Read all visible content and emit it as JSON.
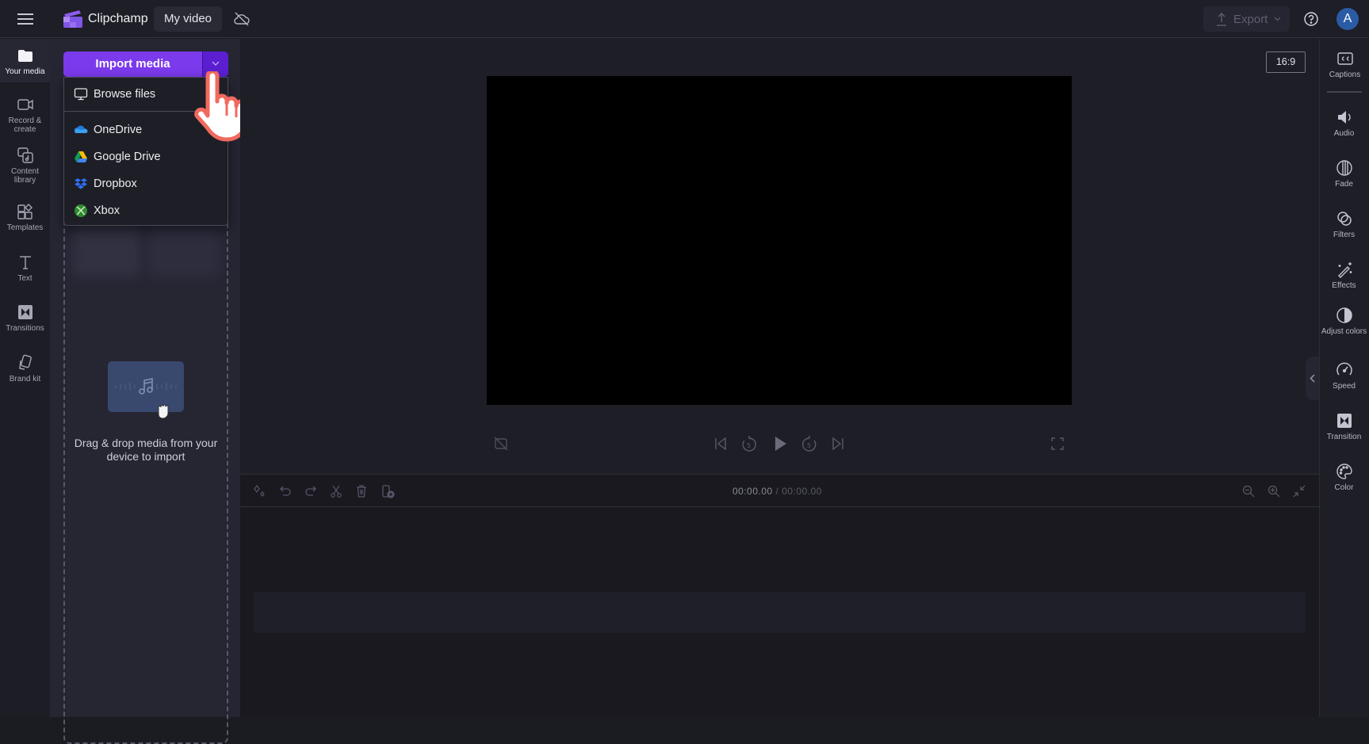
{
  "app": {
    "name": "Clipchamp",
    "project_title": "My video",
    "export_label": "Export",
    "avatar_initial": "A",
    "accent_color": "#7c3aed"
  },
  "left_rail": {
    "items": [
      {
        "label": "Your media",
        "icon": "folder-icon",
        "active": true
      },
      {
        "label": "Record & create",
        "icon": "video-camera-icon"
      },
      {
        "label": "Content library",
        "icon": "content-library-icon"
      },
      {
        "label": "Templates",
        "icon": "templates-icon"
      },
      {
        "label": "Text",
        "icon": "text-icon"
      },
      {
        "label": "Transitions",
        "icon": "transitions-icon"
      },
      {
        "label": "Brand kit",
        "icon": "brand-kit-icon"
      }
    ]
  },
  "media_panel": {
    "import_label": "Import media",
    "drop_text": "Drag & drop media from your device to import"
  },
  "import_menu": {
    "items": [
      {
        "label": "Browse files",
        "icon": "monitor-icon"
      },
      {
        "label": "OneDrive",
        "icon": "onedrive-icon"
      },
      {
        "label": "Google Drive",
        "icon": "google-drive-icon"
      },
      {
        "label": "Dropbox",
        "icon": "dropbox-icon"
      },
      {
        "label": "Xbox",
        "icon": "xbox-icon"
      }
    ]
  },
  "preview": {
    "aspect_ratio": "16:9"
  },
  "timeline": {
    "current_time": "00:00.00",
    "separator": " / ",
    "total_time": "00:00.00"
  },
  "right_rail": {
    "items": [
      {
        "label": "Captions",
        "icon": "cc-icon"
      },
      {
        "label": "Audio",
        "icon": "speaker-icon"
      },
      {
        "label": "Fade",
        "icon": "fade-icon"
      },
      {
        "label": "Filters",
        "icon": "filters-icon"
      },
      {
        "label": "Effects",
        "icon": "magic-wand-icon"
      },
      {
        "label": "Adjust colors",
        "icon": "contrast-icon"
      },
      {
        "label": "Speed",
        "icon": "speedometer-icon"
      },
      {
        "label": "Transition",
        "icon": "transition-icon"
      },
      {
        "label": "Color",
        "icon": "palette-icon"
      }
    ]
  }
}
